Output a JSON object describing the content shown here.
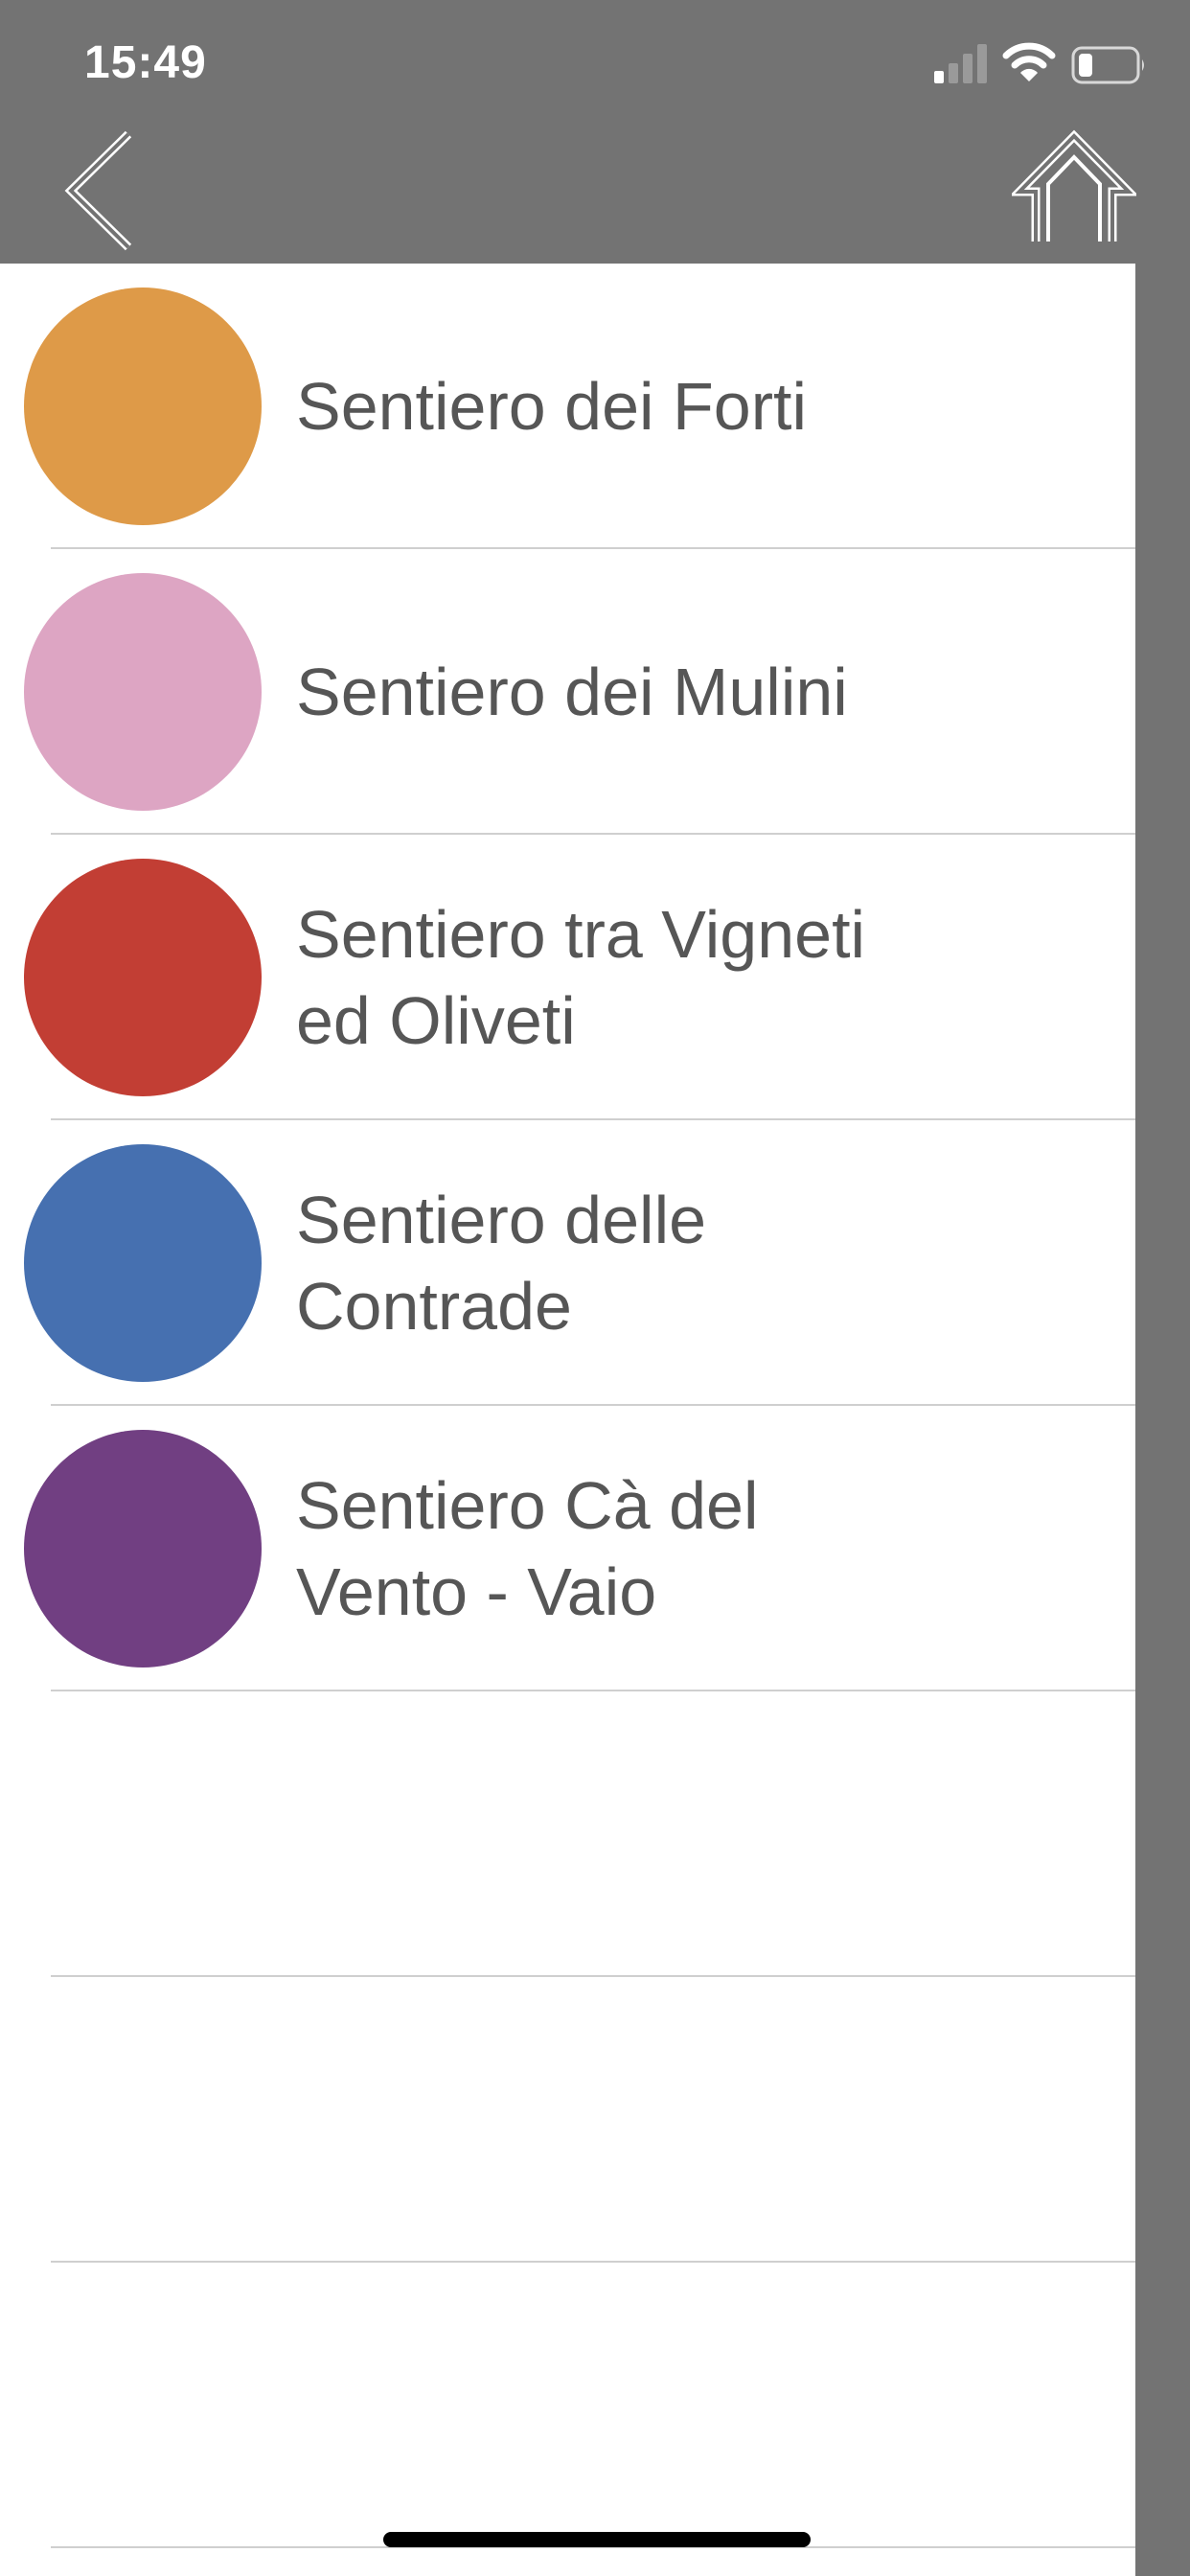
{
  "status_bar": {
    "time": "15:49",
    "signal_icon": "cellular-signal-icon",
    "wifi_icon": "wifi-icon",
    "battery_icon": "battery-icon"
  },
  "nav": {
    "back_icon": "chevron-left-icon",
    "home_icon": "home-icon"
  },
  "trails": [
    {
      "label": "Sentiero dei Forti",
      "color": "#DE9A48"
    },
    {
      "label": "Sentiero dei Mulini",
      "color": "#DDA5C3"
    },
    {
      "label": "Sentiero tra Vigneti ed Oliveti",
      "color": "#C23E34"
    },
    {
      "label": "Sentiero delle Contrade",
      "color": "#4670B0"
    },
    {
      "label": "Sentiero Cà del Vento - Vaio",
      "color": "#713F82"
    },
    {
      "label": "",
      "color": ""
    },
    {
      "label": "",
      "color": ""
    },
    {
      "label": "",
      "color": ""
    }
  ],
  "colors": {
    "chrome_gray": "#737373",
    "text": "#565656",
    "divider": "#CFCFCF"
  }
}
